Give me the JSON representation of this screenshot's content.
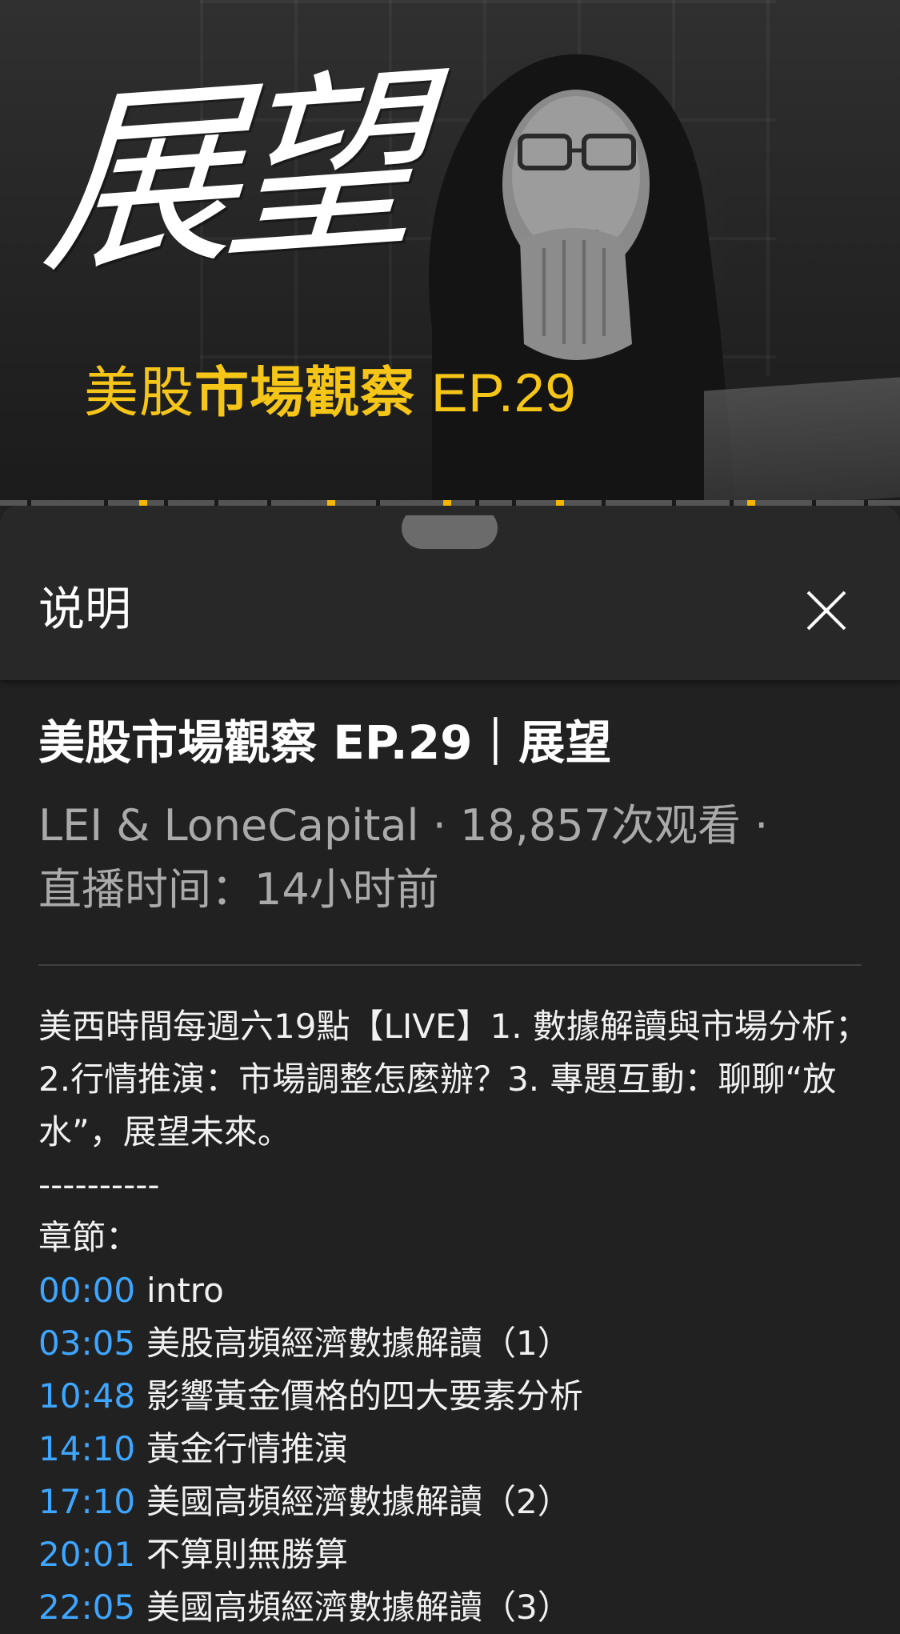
{
  "video": {
    "hero_title": "展望",
    "hero_subtitle_light": "美股",
    "hero_subtitle_bold": "市場觀察",
    "hero_subtitle_ep": "EP.29",
    "accent_color": "#f5c518"
  },
  "sheet": {
    "title": "说明",
    "close_icon": "close-icon"
  },
  "details": {
    "title": "美股市場觀察 EP.29｜展望",
    "meta_line1": "LEI & LoneCapital · 18,857次观看 ·",
    "meta_line2": "直播时间：14小时前"
  },
  "description": {
    "text": "美西時間每週六19點【LIVE】1. 數據解讀與市場分析；2.行情推演：市場調整怎麼辦？3. 專題互動：聊聊“放水”，展望未來。",
    "separator": "----------",
    "chapters_label": "章節：",
    "chapters": [
      {
        "time": "00:00",
        "title": "intro"
      },
      {
        "time": "03:05",
        "title": "美股高頻經濟數據解讀（1）"
      },
      {
        "time": "10:48",
        "title": "影響黃金價格的四大要素分析"
      },
      {
        "time": "14:10",
        "title": "黃金行情推演"
      },
      {
        "time": "17:10",
        "title": "美國高頻經濟數據解讀（2）"
      },
      {
        "time": "20:01",
        "title": "不算則無勝算"
      },
      {
        "time": "22:05",
        "title": "美國高頻經濟數據解讀（3）"
      }
    ]
  },
  "colors": {
    "background": "#212121",
    "header": "#282828",
    "timestamp_link": "#3ea6ff",
    "meta_text": "#aaaaaa"
  }
}
